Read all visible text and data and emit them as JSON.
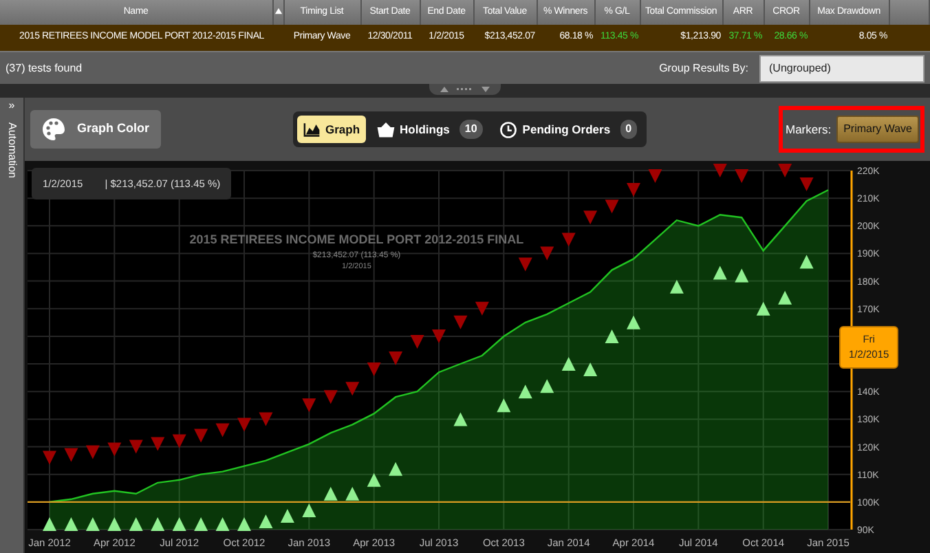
{
  "results_table": {
    "columns": [
      {
        "label": "Name"
      },
      {
        "label": "Timing List"
      },
      {
        "label": "Start Date"
      },
      {
        "label": "End Date"
      },
      {
        "label": "Total Value"
      },
      {
        "label": "% Winners"
      },
      {
        "label": "% G/L"
      },
      {
        "label": "Total Commission"
      },
      {
        "label": "ARR"
      },
      {
        "label": "CROR"
      },
      {
        "label": "Max Drawdown"
      }
    ],
    "rows": [
      {
        "selected": true,
        "cells": [
          {
            "text": "2015 RETIREES INCOME MODEL PORT 2012-2015 FINAL"
          },
          {
            "text": "Primary Wave"
          },
          {
            "text": "12/30/2011"
          },
          {
            "text": "1/2/2015"
          },
          {
            "text": "$213,452.07"
          },
          {
            "text": "68.18 %"
          },
          {
            "text": "113.45 %",
            "kind": "gain"
          },
          {
            "text": "$1,213.90"
          },
          {
            "text": "37.71 %",
            "kind": "gain"
          },
          {
            "text": "28.66 %",
            "kind": "gain"
          },
          {
            "text": "8.05 %"
          }
        ]
      }
    ]
  },
  "status_bar": {
    "count": "(37) tests found",
    "group_label": "Group Results By:",
    "group_value": "(Ungrouped)"
  },
  "side_panel": {
    "label": "Automation",
    "toggle": "»"
  },
  "toolbar": {
    "graph_color": "Graph Color",
    "tabs": [
      {
        "label": "Graph",
        "selected": true
      },
      {
        "label": "Holdings",
        "badge": "10",
        "selected": false
      },
      {
        "label": "Pending Orders",
        "badge": "0",
        "selected": false
      }
    ],
    "markers_label": "Markers:",
    "markers_value": "Primary Wave",
    "markers_highlighted": true
  },
  "chart": {
    "tooltip_date": "1/2/2015",
    "tooltip_value": "| $213,452.07 (113.45 %)",
    "watermark_title": "2015 RETIREES INCOME MODEL PORT 2012-2015 FINAL",
    "watermark_value": "$213,452.07 (113.45 %)",
    "watermark_date": "1/2/2015",
    "cursor_day": "Fri",
    "cursor_date": "1/2/2015",
    "chart_data": {
      "type": "area",
      "categories": [
        "Jan 2012",
        null,
        null,
        "Apr 2012",
        null,
        null,
        "Jul 2012",
        null,
        null,
        "Oct 2012",
        null,
        null,
        "Jan 2013",
        null,
        null,
        "Apr 2013",
        null,
        null,
        "Jul 2013",
        null,
        null,
        "Oct 2013",
        null,
        null,
        "Jan 2014",
        null,
        null,
        "Apr 2014",
        null,
        null,
        "Jul 2014",
        null,
        null,
        "Oct 2014",
        null,
        null,
        "Jan 2015"
      ],
      "ylim": [
        90,
        220
      ],
      "grid": true,
      "yticks": [
        {
          "value": 90,
          "label": "90K"
        },
        {
          "value": 100,
          "label": "100K"
        },
        {
          "value": 110,
          "label": "110K"
        },
        {
          "value": 120,
          "label": "120K"
        },
        {
          "value": 130,
          "label": "130K"
        },
        {
          "value": 140,
          "label": "140K"
        },
        {
          "value": 170,
          "label": "170K"
        },
        {
          "value": 180,
          "label": "180K"
        },
        {
          "value": 190,
          "label": "190K"
        },
        {
          "value": 200,
          "label": "200K"
        },
        {
          "value": 210,
          "label": "210K"
        },
        {
          "value": 220,
          "label": "220K"
        }
      ],
      "series": [
        {
          "color": "#22c422",
          "values": [
            100,
            101,
            103,
            104,
            103,
            107,
            108,
            110,
            111,
            113,
            115,
            118,
            121,
            125,
            128,
            132,
            138,
            140,
            147,
            150,
            153,
            160,
            165,
            168,
            172,
            176,
            184,
            188,
            195,
            202,
            200,
            204,
            203,
            191,
            200,
            209,
            213
          ]
        },
        {
          "type": "scatter",
          "color": "#a00000",
          "values": [
            116,
            117,
            118,
            119,
            120,
            121,
            122,
            124,
            126,
            128,
            130,
            null,
            135,
            138,
            141,
            148,
            152,
            158,
            160,
            165,
            170,
            null,
            186,
            190,
            195,
            203,
            207,
            213,
            218,
            null,
            null,
            220,
            218,
            null,
            220,
            215,
            null
          ]
        },
        {
          "type": "scatter",
          "color": "#90f090",
          "values": [
            92,
            92,
            92,
            92,
            92,
            92,
            92,
            92,
            92,
            92,
            93,
            95,
            97,
            103,
            103,
            108,
            112,
            null,
            null,
            130,
            null,
            135,
            140,
            142,
            150,
            148,
            160,
            165,
            null,
            178,
            null,
            183,
            182,
            170,
            174,
            187,
            null
          ]
        }
      ],
      "ref_lines": [
        {
          "value": 100,
          "axis": "y",
          "color": "#d89a20"
        }
      ]
    }
  }
}
